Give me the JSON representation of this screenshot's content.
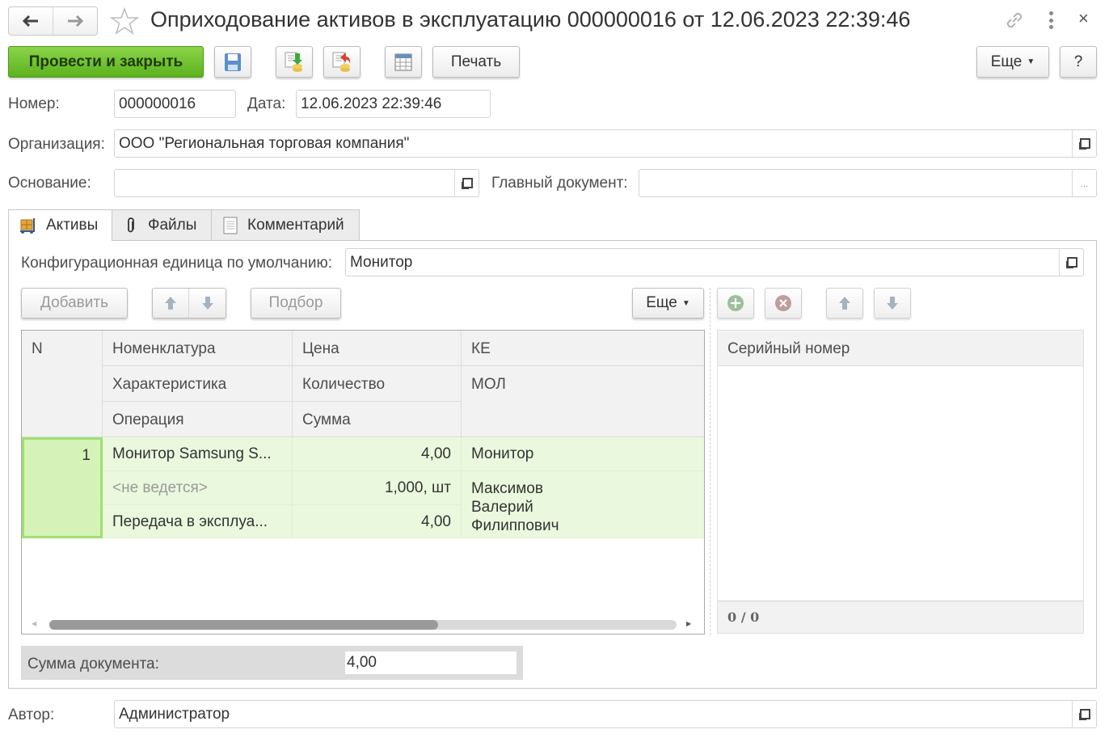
{
  "window": {
    "title": "Оприходование активов в эксплуатацию 000000016 от 12.06.2023 22:39:46",
    "icons": [
      "back-arrow-icon",
      "forward-arrow-icon",
      "favorite-star-icon",
      "link-icon",
      "more-vertical-icon",
      "close-icon"
    ]
  },
  "toolbar": {
    "post_and_close": "Провести и закрыть",
    "print": "Печать",
    "more": "Еще",
    "help": "?",
    "icons": [
      "save-icon",
      "post-icon",
      "unpost-icon",
      "structure-table-icon"
    ]
  },
  "header": {
    "number_label": "Номер:",
    "number_value": "000000016",
    "date_label": "Дата:",
    "date_value": "12.06.2023 22:39:46",
    "org_label": "Организация:",
    "org_value": "ООО \"Региональная торговая компания\"",
    "basis_label": "Основание:",
    "basis_value": "",
    "main_doc_label": "Главный документ:",
    "main_doc_value": "",
    "main_doc_button": "..."
  },
  "tabs": [
    {
      "label": "Активы",
      "icon": "assets-cart-icon",
      "active": true
    },
    {
      "label": "Файлы",
      "icon": "paperclip-icon",
      "active": false
    },
    {
      "label": "Комментарий",
      "icon": "document-icon",
      "active": false
    }
  ],
  "assets": {
    "default_ci_label": "Конфигурационная единица по умолчанию:",
    "default_ci_value": "Монитор",
    "add_button": "Добавить",
    "pick_button": "Подбор",
    "more_button": "Еще",
    "columns": {
      "n": "N",
      "nomenclature": "Номенклатура",
      "characteristic": "Характеристика",
      "operation": "Операция",
      "price": "Цена",
      "quantity": "Количество",
      "sum": "Сумма",
      "ci": "КЕ",
      "mol": "МОЛ"
    },
    "rows": [
      {
        "n": "1",
        "nomenclature": "Монитор Samsung S...",
        "characteristic": "<не ведется>",
        "operation": "Передача в эксплуа...",
        "price": "4,00",
        "quantity": "1,000, шт",
        "sum": "4,00",
        "ci": "Монитор",
        "mol": "Максимов Валерий Филиппович"
      }
    ],
    "scroll_position": 0.62
  },
  "serials": {
    "column": "Серийный номер",
    "counter": "0 / 0"
  },
  "totals": {
    "doc_sum_label": "Сумма документа:",
    "doc_sum_value": "4,00"
  },
  "footer": {
    "author_label": "Автор:",
    "author_value": "Администратор"
  }
}
